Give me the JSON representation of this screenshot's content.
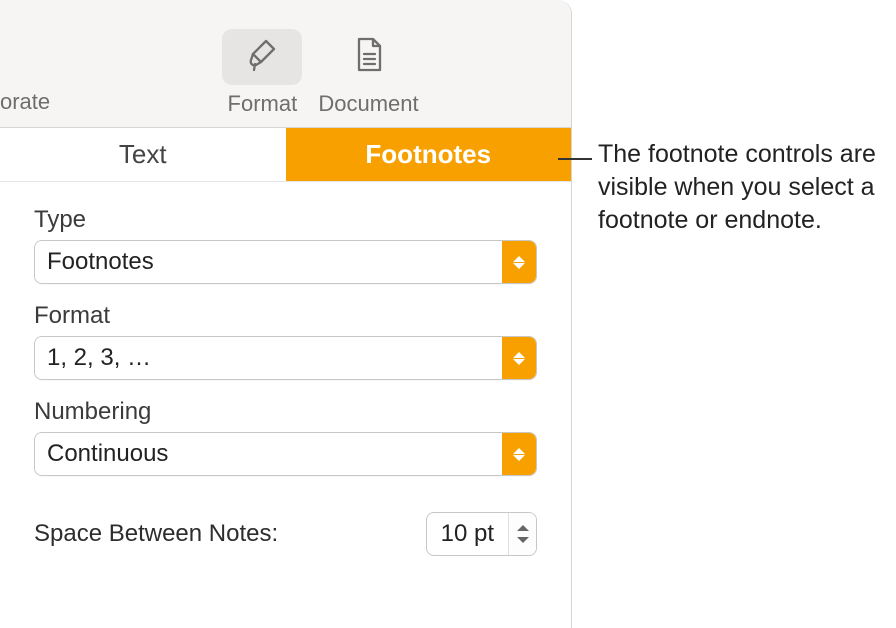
{
  "toolbar": {
    "left_label": "orate",
    "format_label": "Format",
    "document_label": "Document"
  },
  "tabs": {
    "text_label": "Text",
    "footnotes_label": "Footnotes"
  },
  "controls": {
    "type_label": "Type",
    "type_value": "Footnotes",
    "format_label": "Format",
    "format_value": "1, 2, 3, …",
    "numbering_label": "Numbering",
    "numbering_value": "Continuous",
    "space_label": "Space Between Notes:",
    "space_value": "10 pt"
  },
  "callout": {
    "text": "The footnote controls are visible when you select a footnote or endnote."
  }
}
